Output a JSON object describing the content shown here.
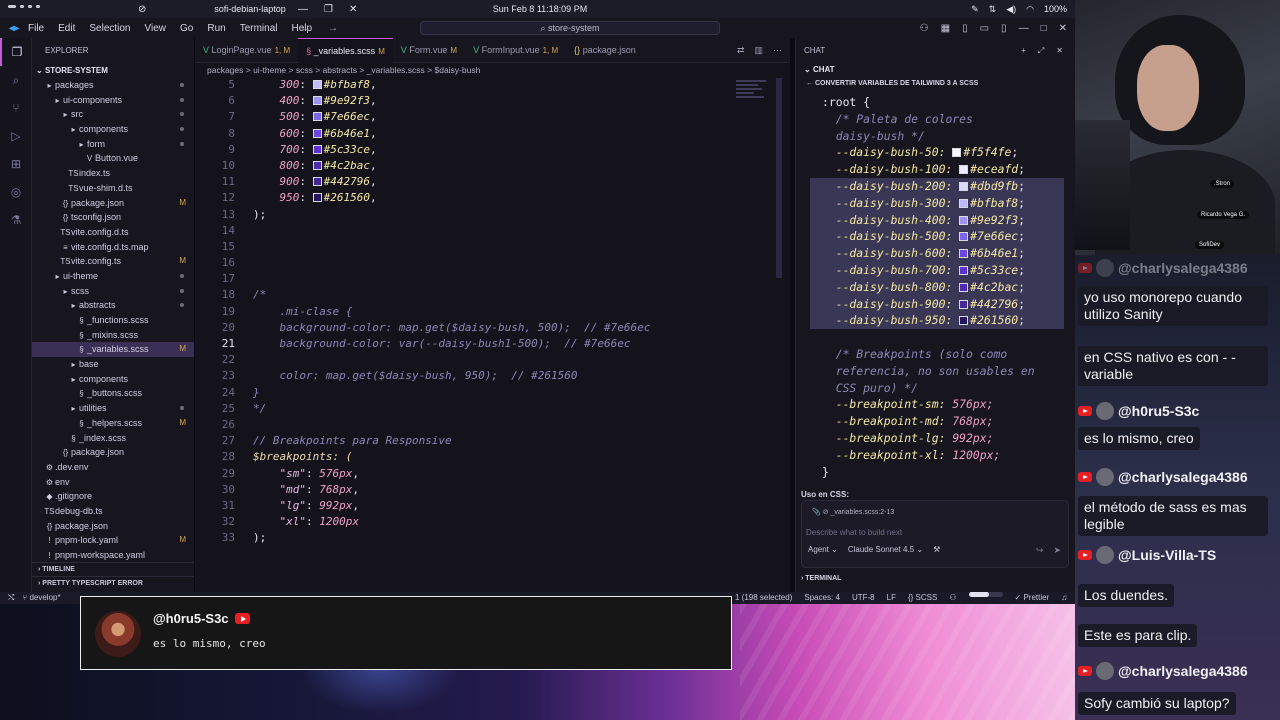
{
  "os": {
    "hostname": "sofi-debian-laptop",
    "datetime": "Sun Feb 8  11:18:09 PM",
    "battery": "100%"
  },
  "titlebar": {
    "menu": [
      "File",
      "Edit",
      "Selection",
      "View",
      "Go",
      "Run",
      "Terminal",
      "Help"
    ],
    "search": "store-system"
  },
  "sidebar": {
    "header": "EXPLORER",
    "project": "STORE-SYSTEM",
    "tree": [
      {
        "label": "packages",
        "indent": 1,
        "icon": "folder",
        "status": "dot"
      },
      {
        "label": "ui-components",
        "indent": 2,
        "icon": "folder",
        "status": "dot"
      },
      {
        "label": "src",
        "indent": 3,
        "icon": "folder",
        "status": "dot"
      },
      {
        "label": "components",
        "indent": 4,
        "icon": "folder",
        "status": "dot"
      },
      {
        "label": "form",
        "indent": 5,
        "icon": "folder",
        "status": "dot"
      },
      {
        "label": "Button.vue",
        "indent": 6,
        "icon": "vue",
        "status": ""
      },
      {
        "label": "index.ts",
        "indent": 4,
        "icon": "ts",
        "status": ""
      },
      {
        "label": "vue-shim.d.ts",
        "indent": 4,
        "icon": "ts",
        "status": ""
      },
      {
        "label": "package.json",
        "indent": 3,
        "icon": "json",
        "status": "M"
      },
      {
        "label": "tsconfig.json",
        "indent": 3,
        "icon": "json",
        "status": ""
      },
      {
        "label": "vite.config.d.ts",
        "indent": 3,
        "icon": "ts",
        "status": ""
      },
      {
        "label": "vite.config.d.ts.map",
        "indent": 3,
        "icon": "file",
        "status": ""
      },
      {
        "label": "vite.config.ts",
        "indent": 3,
        "icon": "ts",
        "status": "M"
      },
      {
        "label": "ui-theme",
        "indent": 2,
        "icon": "folder",
        "status": "dot"
      },
      {
        "label": "scss",
        "indent": 3,
        "icon": "folder",
        "status": "dot"
      },
      {
        "label": "abstracts",
        "indent": 4,
        "icon": "folder",
        "status": "dot"
      },
      {
        "label": "_functions.scss",
        "indent": 5,
        "icon": "scss",
        "status": ""
      },
      {
        "label": "_mixins.scss",
        "indent": 5,
        "icon": "scss",
        "status": ""
      },
      {
        "label": "_variables.scss",
        "indent": 5,
        "icon": "scss",
        "status": "M",
        "selected": true
      },
      {
        "label": "base",
        "indent": 4,
        "icon": "folder",
        "status": ""
      },
      {
        "label": "components",
        "indent": 4,
        "icon": "folder",
        "status": ""
      },
      {
        "label": "_buttons.scss",
        "indent": 5,
        "icon": "scss",
        "status": ""
      },
      {
        "label": "utilities",
        "indent": 4,
        "icon": "folder",
        "status": "dot"
      },
      {
        "label": "_helpers.scss",
        "indent": 5,
        "icon": "scss",
        "status": "M"
      },
      {
        "label": "_index.scss",
        "indent": 4,
        "icon": "scss",
        "status": ""
      },
      {
        "label": "package.json",
        "indent": 3,
        "icon": "json",
        "status": ""
      },
      {
        "label": ".dev.env",
        "indent": 1,
        "icon": "env",
        "status": ""
      },
      {
        "label": "env",
        "indent": 1,
        "icon": "env",
        "status": ""
      },
      {
        "label": ".gitignore",
        "indent": 1,
        "icon": "git",
        "status": ""
      },
      {
        "label": "debug-db.ts",
        "indent": 1,
        "icon": "ts",
        "status": ""
      },
      {
        "label": "package.json",
        "indent": 1,
        "icon": "json",
        "status": ""
      },
      {
        "label": "pnpm-lock.yaml",
        "indent": 1,
        "icon": "yaml",
        "status": "M"
      },
      {
        "label": "pnpm-workspace.yaml",
        "indent": 1,
        "icon": "yaml",
        "status": ""
      }
    ],
    "timeline": "TIMELINE",
    "pretty_errors": "PRETTY TYPESCRIPT ERROR"
  },
  "editor": {
    "tabs": [
      {
        "label": "LoginPage.vue",
        "badge": "1, M",
        "active": false,
        "icon": "vue"
      },
      {
        "label": "_variables.scss",
        "badge": "M",
        "active": true,
        "icon": "scss"
      },
      {
        "label": "Form.vue",
        "badge": "M",
        "active": false,
        "icon": "vue"
      },
      {
        "label": "FormInput.vue",
        "badge": "1, M",
        "active": false,
        "icon": "vue"
      },
      {
        "label": "package.json",
        "badge": "",
        "active": false,
        "icon": "json"
      }
    ],
    "breadcrumb": "packages > ui-theme > scss > abstracts > _variables.scss > $daisy-bush",
    "lines": [
      {
        "n": "5",
        "kind": "color",
        "key": "300",
        "hex": "#bfbaf8",
        "swatch": "#bfbaf8"
      },
      {
        "n": "6",
        "kind": "color",
        "key": "400",
        "hex": "#9e92f3",
        "swatch": "#9e92f3"
      },
      {
        "n": "7",
        "kind": "color",
        "key": "500",
        "hex": "#7e66ec",
        "swatch": "#7e66ec"
      },
      {
        "n": "8",
        "kind": "color",
        "key": "600",
        "hex": "#6b46e1",
        "swatch": "#6b46e1"
      },
      {
        "n": "9",
        "kind": "color",
        "key": "700",
        "hex": "#5c33ce",
        "swatch": "#5c33ce"
      },
      {
        "n": "10",
        "kind": "color",
        "key": "800",
        "hex": "#4c2bac",
        "swatch": "#4c2bac"
      },
      {
        "n": "11",
        "kind": "color",
        "key": "900",
        "hex": "#442796",
        "swatch": "#442796"
      },
      {
        "n": "12",
        "kind": "color",
        "key": "950",
        "hex": "#261560",
        "swatch": "#261560"
      },
      {
        "n": "13",
        "kind": "plain",
        "text": ");"
      },
      {
        "n": "14",
        "kind": "plain",
        "text": ""
      },
      {
        "n": "15",
        "kind": "plain",
        "text": ""
      },
      {
        "n": "16",
        "kind": "plain",
        "text": ""
      },
      {
        "n": "17",
        "kind": "plain",
        "text": ""
      },
      {
        "n": "18",
        "kind": "comment",
        "text": "/*"
      },
      {
        "n": "19",
        "kind": "comment",
        "text": "    .mi-clase {"
      },
      {
        "n": "20",
        "kind": "comment",
        "text": "    background-color: map.get($daisy-bush, 500);  // #7e66ec"
      },
      {
        "n": "21",
        "kind": "comment",
        "text": "    background-color: var(--daisy-bush1-500);  // #7e66ec",
        "current": true
      },
      {
        "n": "22",
        "kind": "plain",
        "text": ""
      },
      {
        "n": "23",
        "kind": "comment",
        "text": "    color: map.get($daisy-bush, 950);  // #261560"
      },
      {
        "n": "24",
        "kind": "comment",
        "text": "}"
      },
      {
        "n": "25",
        "kind": "comment",
        "text": "*/"
      },
      {
        "n": "26",
        "kind": "plain",
        "text": ""
      },
      {
        "n": "27",
        "kind": "comment",
        "text": "// Breakpoints para Responsive"
      },
      {
        "n": "28",
        "kind": "var",
        "text": "$breakpoints: ("
      },
      {
        "n": "29",
        "kind": "bp",
        "key": "\"sm\"",
        "val": "576px"
      },
      {
        "n": "30",
        "kind": "bp",
        "key": "\"md\"",
        "val": "768px"
      },
      {
        "n": "31",
        "kind": "bp",
        "key": "\"lg\"",
        "val": "992px"
      },
      {
        "n": "32",
        "kind": "bp",
        "key": "\"xl\"",
        "val": "1200px",
        "last": true
      },
      {
        "n": "33",
        "kind": "plain",
        "text": ");"
      }
    ]
  },
  "chat": {
    "header": "CHAT",
    "sub": "CHAT",
    "title": "CONVERTIR VARIABLES DE TAILWIND 3 A SCSS",
    "code": [
      {
        "text": ":root {",
        "hl": false
      },
      {
        "text": "  /* Paleta de colores",
        "hl": false,
        "c": "cmt"
      },
      {
        "text": "  daisy-bush */",
        "hl": false,
        "c": "cmt"
      },
      {
        "text": "  --daisy-bush-50: ",
        "hex": "#f5f4fe",
        "swatch": "#f5f4fe",
        "hl": false
      },
      {
        "text": "  --daisy-bush-100: ",
        "hex": "#eceafd",
        "swatch": "#eceafd",
        "hl": false
      },
      {
        "text": "  --daisy-bush-200: ",
        "hex": "#dbd9fb",
        "swatch": "#dbd9fb",
        "hl": true
      },
      {
        "text": "  --daisy-bush-300: ",
        "hex": "#bfbaf8",
        "swatch": "#bfbaf8",
        "hl": true
      },
      {
        "text": "  --daisy-bush-400: ",
        "hex": "#9e92f3",
        "swatch": "#9e92f3",
        "hl": true
      },
      {
        "text": "  --daisy-bush-500: ",
        "hex": "#7e66ec",
        "swatch": "#7e66ec",
        "hl": true
      },
      {
        "text": "  --daisy-bush-600: ",
        "hex": "#6b46e1",
        "swatch": "#6b46e1",
        "hl": true
      },
      {
        "text": "  --daisy-bush-700: ",
        "hex": "#5c33ce",
        "swatch": "#5c33ce",
        "hl": true
      },
      {
        "text": "  --daisy-bush-800: ",
        "hex": "#4c2bac",
        "swatch": "#4c2bac",
        "hl": true
      },
      {
        "text": "  --daisy-bush-900: ",
        "hex": "#442796",
        "swatch": "#442796",
        "hl": true
      },
      {
        "text": "  --daisy-bush-950: ",
        "hex": "#261560",
        "swatch": "#261560",
        "hl": true
      },
      {
        "text": "",
        "hl": false
      },
      {
        "text": "  /* Breakpoints (solo como",
        "hl": false,
        "c": "cmt"
      },
      {
        "text": "  referencia, no son usables en",
        "hl": false,
        "c": "cmt"
      },
      {
        "text": "  CSS puro) */",
        "hl": false,
        "c": "cmt"
      },
      {
        "text": "  --breakpoint-sm: ",
        "hex": "576px;",
        "hl": false
      },
      {
        "text": "  --breakpoint-md: ",
        "hex": "768px;",
        "hl": false
      },
      {
        "text": "  --breakpoint-lg: ",
        "hex": "992px;",
        "hl": false
      },
      {
        "text": "  --breakpoint-xl: ",
        "hex": "1200px;",
        "hl": false
      },
      {
        "text": "}",
        "hl": false
      }
    ],
    "used": "Uso en CSS:",
    "context_file": "_variables.scss:2-13",
    "placeholder": "Describe what to build next",
    "agent": "Agent",
    "model": "Claude Sonnet 4.5",
    "terminal": "TERMINAL"
  },
  "status": {
    "branch": "develop*",
    "selection": "1 (198 selected)",
    "spaces": "Spaces: 4",
    "encoding": "UTF-8",
    "eol": "LF",
    "lang": "SCSS",
    "formatter": "Prettier",
    "progress": 0.6
  },
  "toast": {
    "user": "@h0ru5-S3c",
    "message": "es lo mismo, creo"
  },
  "webcam": {
    "tags": [
      ".Stron",
      "Ricardo Vega G.",
      "SofiDev"
    ]
  },
  "livechat": [
    {
      "type": "user",
      "text": "@charlysalega4386",
      "faded": true
    },
    {
      "type": "msg",
      "text": "yo uso monorepo cuando utilizo Sanity"
    },
    {
      "type": "msg",
      "text": "en CSS nativo es con - - variable"
    },
    {
      "type": "user",
      "text": "@h0ru5-S3c"
    },
    {
      "type": "msg",
      "text": "es lo mismo, creo"
    },
    {
      "type": "user",
      "text": "@charlysalega4386"
    },
    {
      "type": "msg",
      "text": "el método de sass es mas legible"
    },
    {
      "type": "user",
      "text": "@Luis-Villa-TS"
    },
    {
      "type": "msg",
      "text": "Los duendes."
    },
    {
      "type": "msg",
      "text": "Este es para clip."
    },
    {
      "type": "user",
      "text": "@charlysalega4386"
    },
    {
      "type": "msg",
      "text": "Sofy cambió su laptop?"
    }
  ]
}
